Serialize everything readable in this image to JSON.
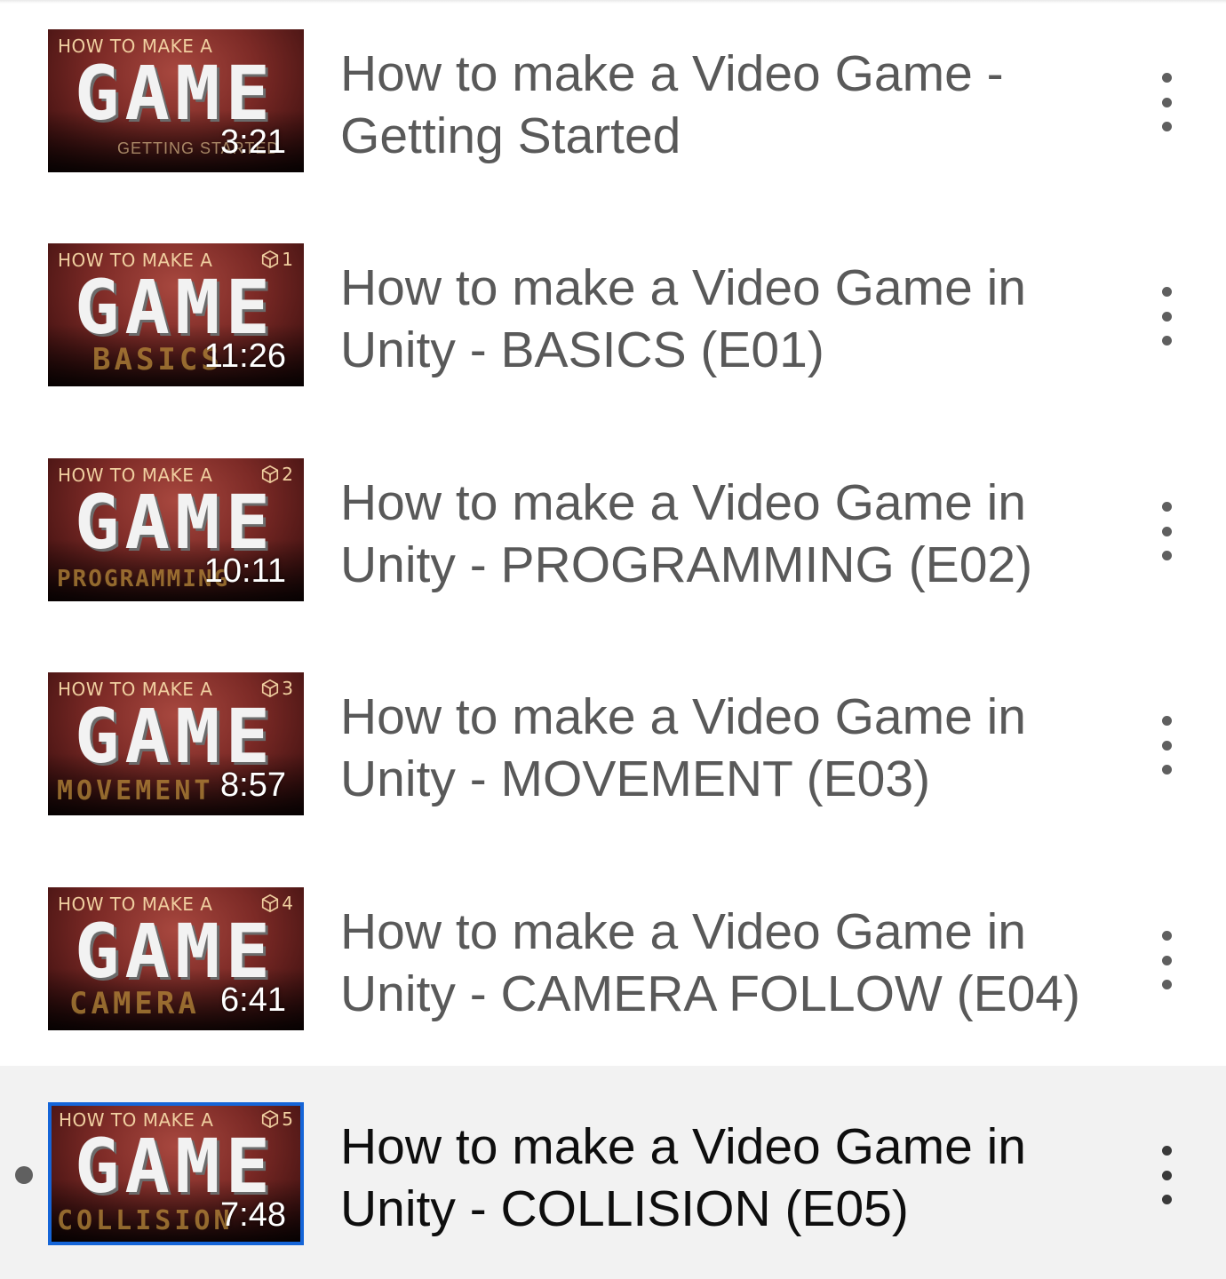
{
  "playlist": {
    "items": [
      {
        "thumb_top": "HOW TO MAKE A",
        "thumb_game": "GAME",
        "thumb_episode": "",
        "thumb_subtitle": "GETTING STARTED",
        "duration": "3:21",
        "title": "How to make a Video Game - Getting Started"
      },
      {
        "thumb_top": "HOW TO MAKE A",
        "thumb_game": "GAME",
        "thumb_episode": "1",
        "thumb_subtitle": "BASICS",
        "duration": "11:26",
        "title": "How to make a Video Game in Unity - BASICS (E01)"
      },
      {
        "thumb_top": "HOW TO MAKE A",
        "thumb_game": "GAME",
        "thumb_episode": "2",
        "thumb_subtitle": "PROGRAMMING",
        "duration": "10:11",
        "title": "How to make a Video Game in Unity - PROGRAMMING (E02)"
      },
      {
        "thumb_top": "HOW TO MAKE A",
        "thumb_game": "GAME",
        "thumb_episode": "3",
        "thumb_subtitle": "MOVEMENT",
        "duration": "8:57",
        "title": "How to make a Video Game in Unity - MOVEMENT (E03)"
      },
      {
        "thumb_top": "HOW TO MAKE A",
        "thumb_game": "GAME",
        "thumb_episode": "4",
        "thumb_subtitle": "CAMERA",
        "duration": "6:41",
        "title": "How to make a Video Game in Unity - CAMERA FOLLOW (E04)"
      },
      {
        "thumb_top": "HOW TO MAKE A",
        "thumb_game": "GAME",
        "thumb_episode": "5",
        "thumb_subtitle": "COLLISION",
        "duration": "7:48",
        "title": "How to make a Video Game in Unity - COLLISION (E05)"
      }
    ],
    "current_index": 5,
    "icons": {
      "episode": "cube-icon",
      "menu": "more-vertical-icon",
      "now_playing": "now-playing-indicator-icon"
    },
    "colors": {
      "current_border": "#1565d8",
      "current_background": "#f2f2f2",
      "title_text": "#595959",
      "current_title_text": "#0e0e0e"
    }
  }
}
